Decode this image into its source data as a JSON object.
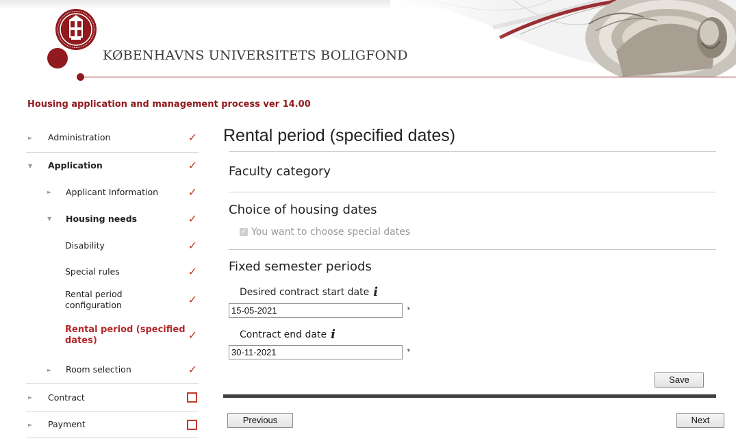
{
  "header": {
    "brand": "KØBENHAVNS UNIVERSITETS BOLIGFOND",
    "process_title": "Housing application and management process ver 14.00"
  },
  "colors": {
    "accent": "#901a1e",
    "check": "#c0392b"
  },
  "sidebar": {
    "items": [
      {
        "label": "Administration",
        "status": "check"
      },
      {
        "label": "Application",
        "status": "check"
      },
      {
        "label": "Applicant Information",
        "status": "check"
      },
      {
        "label": "Housing needs",
        "status": "check"
      },
      {
        "label": "Disability",
        "status": "check"
      },
      {
        "label": "Special rules",
        "status": "check"
      },
      {
        "label": "Rental period configuration",
        "status": "check"
      },
      {
        "label": "Rental period (specified dates)",
        "status": "check",
        "active": true
      },
      {
        "label": "Room selection",
        "status": "check"
      },
      {
        "label": "Contract",
        "status": "empty"
      },
      {
        "label": "Payment",
        "status": "empty"
      }
    ]
  },
  "main": {
    "heading": "Rental period (specified dates)",
    "faculty_category": "Faculty category",
    "choice_heading": "Choice of housing dates",
    "special_dates_label": "You want to choose special dates",
    "special_dates_checked": true,
    "fixed_heading": "Fixed semester periods",
    "start_label": "Desired contract start date",
    "start_value": "15-05-2021",
    "end_label": "Contract end date",
    "end_value": "30-11-2021",
    "required_mark": "*",
    "info_glyph": "i",
    "save_label": "Save",
    "previous_label": "Previous",
    "next_label": "Next"
  }
}
